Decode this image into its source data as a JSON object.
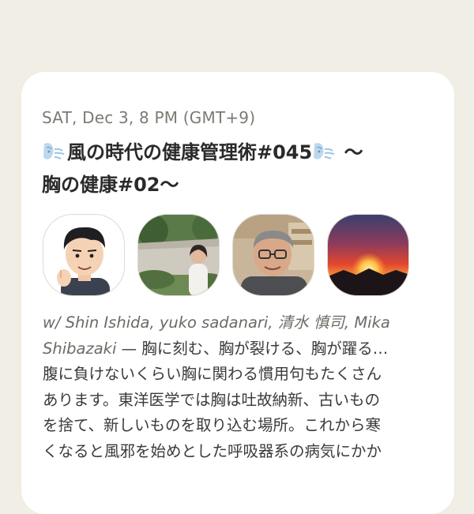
{
  "event": {
    "datetime": "SAT, Dec 3, 8 PM (GMT+9)",
    "title_line1": "風の時代の健康管理術#045",
    "title_line1_suffix": " 〜",
    "title_line2": "胸の健康#02〜",
    "title_icon": "wind-face-icon"
  },
  "speakers": [
    {
      "name": "Shin Ishida",
      "avatar": "cartoon-man-avatar"
    },
    {
      "name": "yuko sadanari",
      "avatar": "woman-garden-photo"
    },
    {
      "name": "清水 慎司",
      "avatar": "man-glasses-photo"
    },
    {
      "name": "Mika Shibazaki",
      "avatar": "sunset-photo"
    }
  ],
  "description": {
    "names_line1": "w/ Shin Ishida, yuko sadanari, 清水 慎司, Mika",
    "names_line2": "Shibazaki",
    "dash": " — ",
    "text_line1": "胸に刻む、胸が裂ける、胸が躍る…",
    "text_line2": "腹に負けないくらい胸に関わる慣用句もたくさん",
    "text_line3": "あります。東洋医学では胸は吐故納新、古いもの",
    "text_line4": "を捨て、新しいものを取り込む場所。これから寒",
    "text_line5": "くなると風邪を始めとした呼吸器系の病気にかか"
  },
  "colors": {
    "background": "#f1efe5",
    "card": "#ffffff",
    "date_text": "#7c7a74",
    "title_text": "#2a2a2a"
  }
}
